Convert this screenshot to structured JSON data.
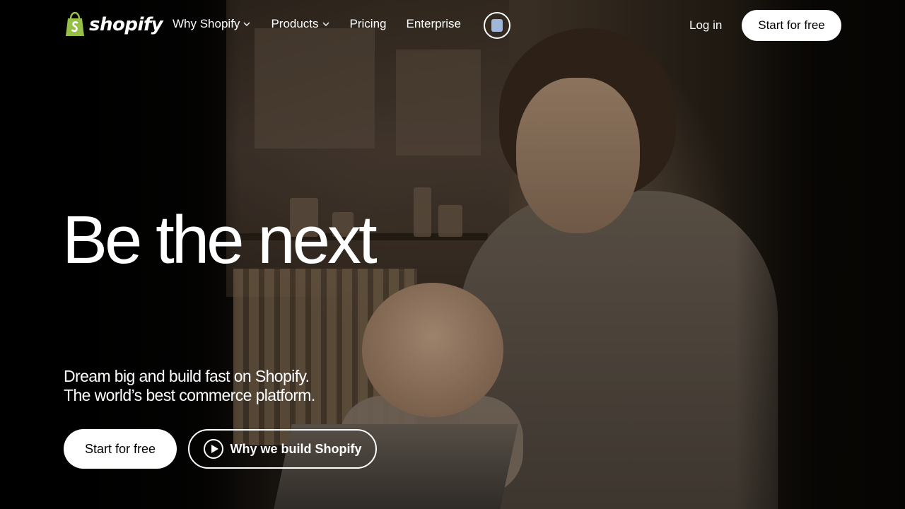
{
  "nav": {
    "logo_text": "shopify",
    "links": [
      {
        "label": "Why Shopify",
        "has_dropdown": true
      },
      {
        "label": "Products",
        "has_dropdown": true
      },
      {
        "label": "Pricing",
        "has_dropdown": false
      },
      {
        "label": "Enterprise",
        "has_dropdown": false
      }
    ],
    "store_icon": "shopping-bag-icon",
    "login_label": "Log in",
    "cta_label": "Start for free"
  },
  "hero": {
    "headline": "Be the next",
    "subline_1": "Dream big and build fast on Shopify.",
    "subline_2": "The world’s best commerce platform.",
    "primary_cta": "Start for free",
    "secondary_cta": "Why we build Shopify",
    "secondary_icon": "play-icon"
  },
  "colors": {
    "logo_bag": "#95bf47",
    "button_bg": "#ffffff",
    "button_text": "#000000",
    "text": "#ffffff",
    "background": "#000000"
  }
}
